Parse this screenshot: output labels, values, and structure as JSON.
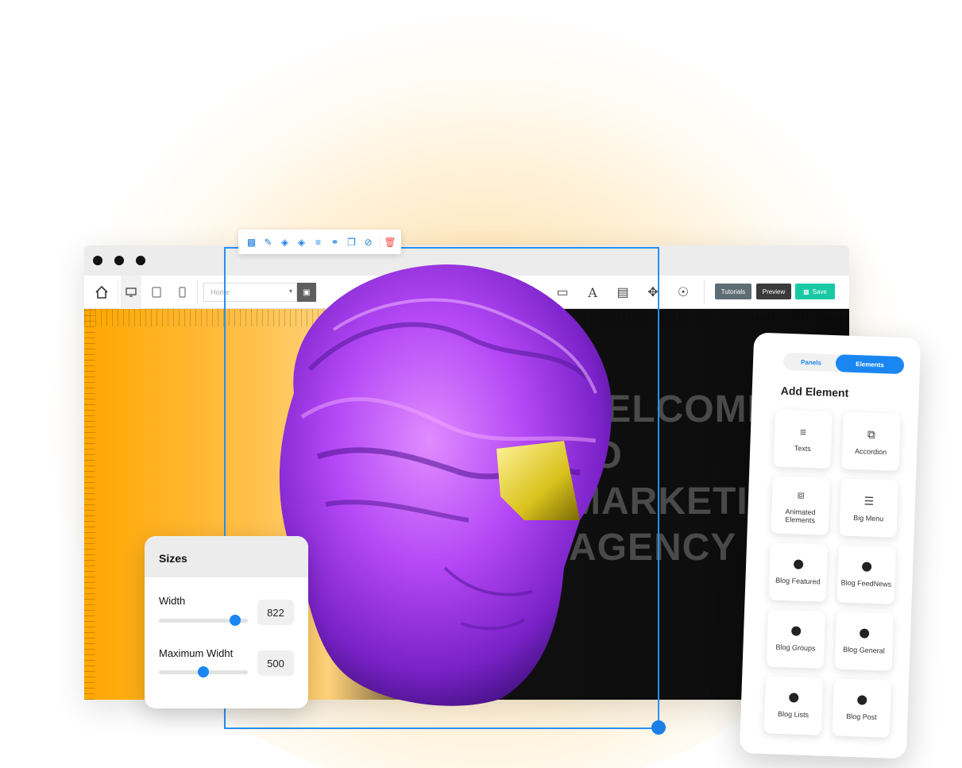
{
  "editor": {
    "page_select": "Home",
    "buttons": {
      "tutorials": "Tutorials",
      "preview": "Preview",
      "save": "Save"
    },
    "canvas_heading": [
      "WELCOME",
      "TO",
      "MARKETING",
      "AGENCY"
    ]
  },
  "sizes_panel": {
    "title": "Sizes",
    "width_label": "Width",
    "width_value": "822",
    "width_level": 0.86,
    "max_width_label": "Maximum Widht",
    "max_width_value": "500",
    "max_width_level": 0.5
  },
  "elements_panel": {
    "tab_panels": "Panels",
    "tab_elements": "Elements",
    "title": "Add Element",
    "items": [
      {
        "label": "Texts",
        "icon": "text-lines-icon"
      },
      {
        "label": "Accordion",
        "icon": "accordion-icon"
      },
      {
        "label": "Animated Elements",
        "icon": "animated-icon"
      },
      {
        "label": "Big Menu",
        "icon": "menu-icon"
      },
      {
        "label": "Blog Featured",
        "icon": "dot-icon"
      },
      {
        "label": "Blog FeedNews",
        "icon": "dot-icon"
      },
      {
        "label": "Blog Groups",
        "icon": "dot-icon"
      },
      {
        "label": "Blog General",
        "icon": "dot-icon"
      },
      {
        "label": "Blog Lists",
        "icon": "dot-icon"
      },
      {
        "label": "Blog Post",
        "icon": "dot-icon"
      }
    ]
  },
  "colors": {
    "accent_blue": "#1a86f2",
    "save_green": "#19c9a4",
    "canvas_orange": "#ffa600",
    "statue_purple": "#a83cf0"
  }
}
